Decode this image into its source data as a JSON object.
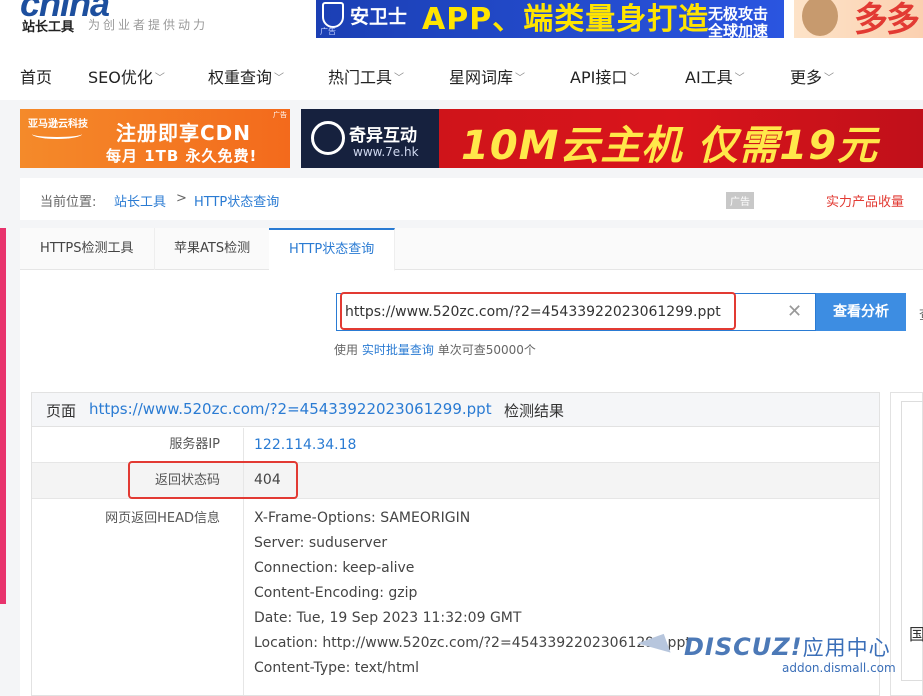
{
  "header": {
    "logo_text": "china",
    "logo_sub": "站长工具",
    "logo_tagline": "为创业者提供动力",
    "top_ad1": {
      "brand": "安卫士",
      "slogan": "APP、端类量身打造",
      "side_line1": "无极攻击",
      "side_line2": "全球加速",
      "tag": "广告"
    },
    "top_ad2": {
      "text": "多多"
    }
  },
  "nav": {
    "items": [
      {
        "label": "首页",
        "caret": false
      },
      {
        "label": "SEO优化",
        "caret": true
      },
      {
        "label": "权重查询",
        "caret": true
      },
      {
        "label": "热门工具",
        "caret": true
      },
      {
        "label": "星网词库",
        "caret": true
      },
      {
        "label": "API接口",
        "caret": true
      },
      {
        "label": "AI工具",
        "caret": true
      },
      {
        "label": "更多",
        "caret": true
      }
    ],
    "caret_glyph": "﹀"
  },
  "ads": {
    "aws": {
      "corner": "亚马逊云科技",
      "line1": "注册即享CDN",
      "line2": "每月 1TB 永久免费!",
      "mark": "广告"
    },
    "qiyi": {
      "name": "奇异互动",
      "url": "www.7e.hk",
      "headline": "10M云主机 仅需19元"
    }
  },
  "breadcrumb": {
    "prefix": "当前位置:",
    "home": "站长工具",
    "sep": ">",
    "current": "HTTP状态查询",
    "ad_label": "广告",
    "right_link": "实力产品收量"
  },
  "tabs": [
    "HTTPS检测工具",
    "苹果ATS检测",
    "HTTP状态查询"
  ],
  "active_tab": 2,
  "search": {
    "value": "https://www.520zc.com/?2=45433922023061299.ppt",
    "clear_glyph": "✕",
    "button": "查看分析",
    "hint_prefix": "使用",
    "hint_link": "实时批量查询",
    "hint_suffix": "单次可查50000个",
    "right_cut": "查"
  },
  "result": {
    "page_label": "页面",
    "url": "https://www.520zc.com/?2=45433922023061299.ppt",
    "suffix": "检测结果",
    "server_ip_label": "服务器IP",
    "server_ip": "122.114.34.18",
    "status_label": "返回状态码",
    "status_code": "404",
    "head_label": "网页返回HEAD信息",
    "head_lines": [
      "X-Frame-Options: SAMEORIGIN",
      "Server: suduserver",
      "Connection: keep-alive",
      "Content-Encoding: gzip",
      "Date: Tue, 19 Sep 2023 11:32:09 GMT",
      "Location: http://www.520zc.com/?2=45433922023061299.ppt",
      "Content-Type: text/html"
    ]
  },
  "side_glyph": "国",
  "watermark": {
    "brand": "DISCUZ!",
    "cn": "应用中心",
    "site": "addon.dismall.com"
  },
  "colors": {
    "link": "#2a7bd3",
    "highlight": "#e23a33",
    "button": "#3d8de2"
  }
}
